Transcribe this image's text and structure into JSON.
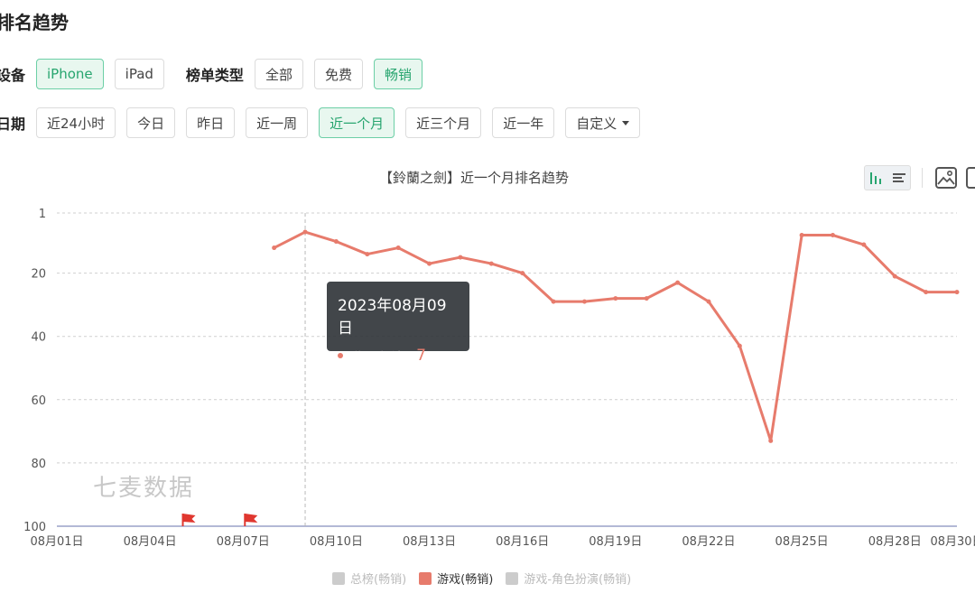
{
  "page": {
    "title": "排名趋势"
  },
  "filters": {
    "device_label": "设备",
    "devices": [
      {
        "label": "iPhone",
        "active": true
      },
      {
        "label": "iPad",
        "active": false
      }
    ],
    "chart_type_label": "榜单类型",
    "chart_types": [
      {
        "label": "全部",
        "active": false
      },
      {
        "label": "免费",
        "active": false
      },
      {
        "label": "畅销",
        "active": true
      }
    ],
    "date_label": "日期",
    "dates": [
      {
        "label": "近24小时",
        "active": false
      },
      {
        "label": "今日",
        "active": false
      },
      {
        "label": "昨日",
        "active": false
      },
      {
        "label": "近一周",
        "active": false
      },
      {
        "label": "近一个月",
        "active": true
      },
      {
        "label": "近三个月",
        "active": false
      },
      {
        "label": "近一年",
        "active": false
      },
      {
        "label": "自定义",
        "active": false,
        "dropdown": true
      }
    ]
  },
  "tooltip": {
    "date": "2023年08月09日",
    "series": "游戏(畅销)",
    "value": "7"
  },
  "watermark": "七麦数据",
  "colors": {
    "accent": "#27a56f",
    "series_line": "#e77b6c",
    "flag": "#e0372f",
    "legend_inactive": "#cccccc"
  },
  "icons": [
    "bar-chart-icon",
    "list-icon",
    "save-image-icon",
    "export-icon",
    "flag-icon"
  ],
  "chart_data": {
    "type": "line",
    "title": "【鈴蘭之劍】近一个月排名趋势",
    "y_inverse": true,
    "ylim": [
      1,
      100
    ],
    "y_ticks": [
      1,
      20,
      40,
      60,
      80,
      100
    ],
    "x": [
      "08月01日",
      "08月02日",
      "08月03日",
      "08月04日",
      "08月05日",
      "08月06日",
      "08月07日",
      "08月08日",
      "08月09日",
      "08月10日",
      "08月11日",
      "08月12日",
      "08月13日",
      "08月14日",
      "08月15日",
      "08月16日",
      "08月17日",
      "08月18日",
      "08月19日",
      "08月20日",
      "08月21日",
      "08月22日",
      "08月23日",
      "08月24日",
      "08月25日",
      "08月26日",
      "08月27日",
      "08月28日",
      "08月29日",
      "08月30日"
    ],
    "x_tick_labels": [
      "08月01日",
      "08月04日",
      "08月07日",
      "08月10日",
      "08月13日",
      "08月16日",
      "08月19日",
      "08月22日",
      "08月25日",
      "08月28日",
      "08月30日"
    ],
    "series": [
      {
        "name": "总榜(畅销)",
        "visible": false,
        "values": []
      },
      {
        "name": "游戏(畅销)",
        "visible": true,
        "values": [
          null,
          null,
          null,
          null,
          null,
          null,
          null,
          12,
          7,
          10,
          14,
          12,
          17,
          15,
          17,
          20,
          29,
          29,
          28,
          28,
          23,
          29,
          43,
          73,
          8,
          8,
          11,
          21,
          26,
          26
        ]
      },
      {
        "name": "游戏-角色扮演(畅销)",
        "visible": false,
        "values": []
      }
    ],
    "flags": [
      "08月05日",
      "08月07日"
    ],
    "highlight_x": "08月09日",
    "grid": true,
    "legend_position": "bottom"
  }
}
